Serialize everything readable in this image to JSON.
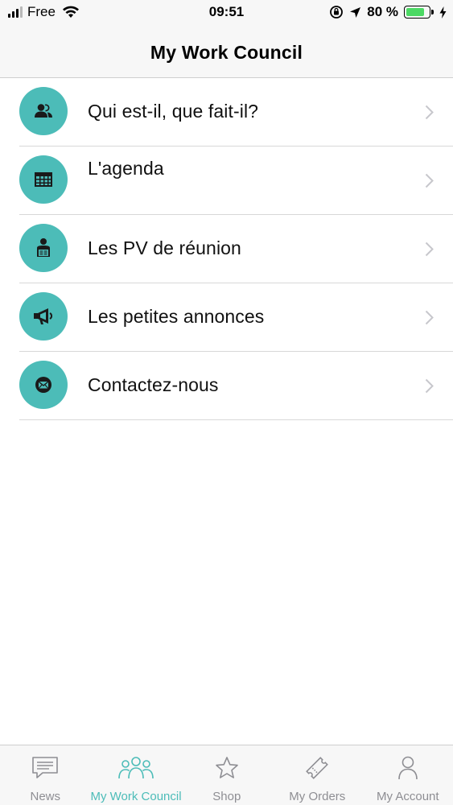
{
  "status_bar": {
    "carrier": "Free",
    "time": "09:51",
    "battery": "80 %"
  },
  "nav": {
    "title": "My Work Council"
  },
  "menu": {
    "items": [
      {
        "label": "Qui est-il, que fait-il?",
        "icon": "person-card-icon"
      },
      {
        "label": "L'agenda",
        "icon": "calendar-grid-icon"
      },
      {
        "label": "Les PV de réunion",
        "icon": "reading-document-icon"
      },
      {
        "label": "Les petites annonces",
        "icon": "megaphone-icon"
      },
      {
        "label": "Contactez-nous",
        "icon": "envelope-icon"
      }
    ]
  },
  "tabs": [
    {
      "label": "News",
      "icon": "message-icon",
      "active": false
    },
    {
      "label": "My Work Council",
      "icon": "group-icon",
      "active": true
    },
    {
      "label": "Shop",
      "icon": "star-icon",
      "active": false
    },
    {
      "label": "My Orders",
      "icon": "ticket-icon",
      "active": false
    },
    {
      "label": "My Account",
      "icon": "person-icon",
      "active": false
    }
  ],
  "colors": {
    "accent": "#4cbcb8",
    "battery_fill": "#4cd964",
    "inactive_tab": "#8e8e93"
  }
}
